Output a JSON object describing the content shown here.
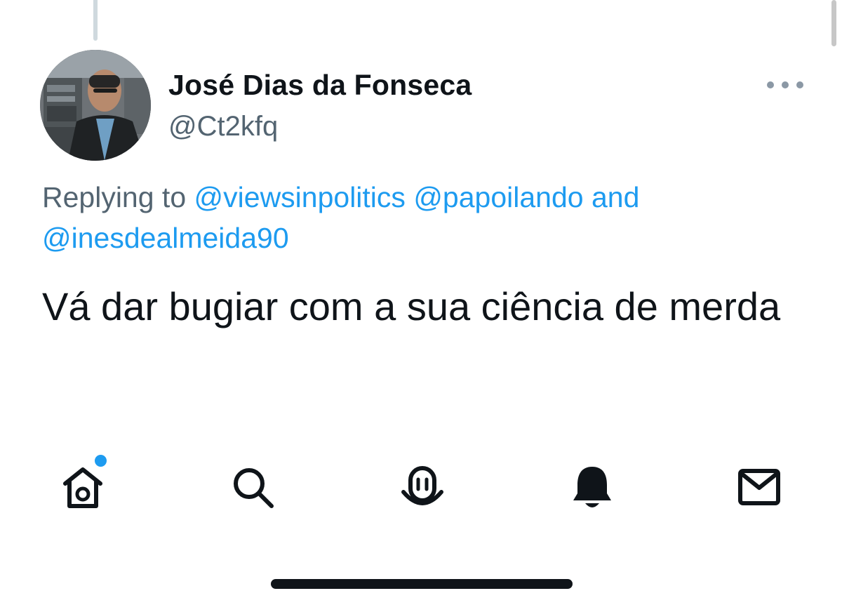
{
  "tweet": {
    "author": {
      "display_name": "José Dias da Fonseca",
      "handle": "@Ct2kfq"
    },
    "reply_context": {
      "prefix": "Replying to",
      "mentions": [
        "@viewsinpolitics",
        "@papoilando",
        "@inesdealmeida90"
      ],
      "conjunction": "and"
    },
    "text": "Vá dar bugiar com a sua ciência de merda"
  },
  "tabbar": {
    "items": [
      {
        "name": "home",
        "icon": "home-icon",
        "has_notification_dot": true
      },
      {
        "name": "search",
        "icon": "search-icon"
      },
      {
        "name": "spaces",
        "icon": "spaces-icon"
      },
      {
        "name": "notifications",
        "icon": "bell-icon"
      },
      {
        "name": "messages",
        "icon": "mail-icon"
      }
    ]
  },
  "colors": {
    "text_primary": "#0f1419",
    "text_secondary": "#536471",
    "link": "#1d9bf0",
    "notification_dot": "#1d9bf0",
    "background": "#ffffff"
  }
}
